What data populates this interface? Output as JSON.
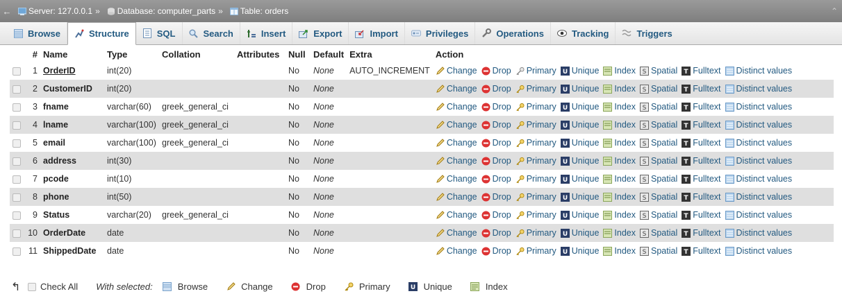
{
  "breadcrumb": {
    "server": "Server: 127.0.0.1",
    "database": "Database: computer_parts",
    "table": "Table: orders",
    "separator": "»"
  },
  "tabs": [
    {
      "label": "Browse",
      "icon": "browse-icon"
    },
    {
      "label": "Structure",
      "icon": "structure-icon",
      "active": true
    },
    {
      "label": "SQL",
      "icon": "sql-icon"
    },
    {
      "label": "Search",
      "icon": "search-icon"
    },
    {
      "label": "Insert",
      "icon": "insert-icon"
    },
    {
      "label": "Export",
      "icon": "export-icon"
    },
    {
      "label": "Import",
      "icon": "import-icon"
    },
    {
      "label": "Privileges",
      "icon": "privileges-icon"
    },
    {
      "label": "Operations",
      "icon": "operations-icon"
    },
    {
      "label": "Tracking",
      "icon": "tracking-icon"
    },
    {
      "label": "Triggers",
      "icon": "triggers-icon"
    }
  ],
  "columns": {
    "num": "#",
    "name": "Name",
    "type": "Type",
    "collation": "Collation",
    "attributes": "Attributes",
    "null": "Null",
    "default": "Default",
    "extra": "Extra",
    "action": "Action"
  },
  "actions": {
    "change": "Change",
    "drop": "Drop",
    "primary": "Primary",
    "unique": "Unique",
    "index": "Index",
    "spatial": "Spatial",
    "fulltext": "Fulltext",
    "distinct": "Distinct values"
  },
  "rows": [
    {
      "num": "1",
      "name": "OrderID",
      "type": "int(20)",
      "collation": "",
      "attributes": "",
      "null": "No",
      "default": "None",
      "extra": "AUTO_INCREMENT",
      "primary_key": true
    },
    {
      "num": "2",
      "name": "CustomerID",
      "type": "int(20)",
      "collation": "",
      "attributes": "",
      "null": "No",
      "default": "None",
      "extra": ""
    },
    {
      "num": "3",
      "name": "fname",
      "type": "varchar(60)",
      "collation": "greek_general_ci",
      "attributes": "",
      "null": "No",
      "default": "None",
      "extra": ""
    },
    {
      "num": "4",
      "name": "lname",
      "type": "varchar(100)",
      "collation": "greek_general_ci",
      "attributes": "",
      "null": "No",
      "default": "None",
      "extra": ""
    },
    {
      "num": "5",
      "name": "email",
      "type": "varchar(100)",
      "collation": "greek_general_ci",
      "attributes": "",
      "null": "No",
      "default": "None",
      "extra": ""
    },
    {
      "num": "6",
      "name": "address",
      "type": "int(30)",
      "collation": "",
      "attributes": "",
      "null": "No",
      "default": "None",
      "extra": ""
    },
    {
      "num": "7",
      "name": "pcode",
      "type": "int(10)",
      "collation": "",
      "attributes": "",
      "null": "No",
      "default": "None",
      "extra": ""
    },
    {
      "num": "8",
      "name": "phone",
      "type": "int(50)",
      "collation": "",
      "attributes": "",
      "null": "No",
      "default": "None",
      "extra": ""
    },
    {
      "num": "9",
      "name": "Status",
      "type": "varchar(20)",
      "collation": "greek_general_ci",
      "attributes": "",
      "null": "No",
      "default": "None",
      "extra": ""
    },
    {
      "num": "10",
      "name": "OrderDate",
      "type": "date",
      "collation": "",
      "attributes": "",
      "null": "No",
      "default": "None",
      "extra": ""
    },
    {
      "num": "11",
      "name": "ShippedDate",
      "type": "date",
      "collation": "",
      "attributes": "",
      "null": "No",
      "default": "None",
      "extra": ""
    }
  ],
  "footer": {
    "check_all": "Check All",
    "with_selected": "With selected:",
    "browse": "Browse",
    "change": "Change",
    "drop": "Drop",
    "primary": "Primary",
    "unique": "Unique",
    "index": "Index"
  },
  "colors": {
    "link": "#235a81",
    "row_alt": "#dfdfdf",
    "topbar": "#888888"
  }
}
